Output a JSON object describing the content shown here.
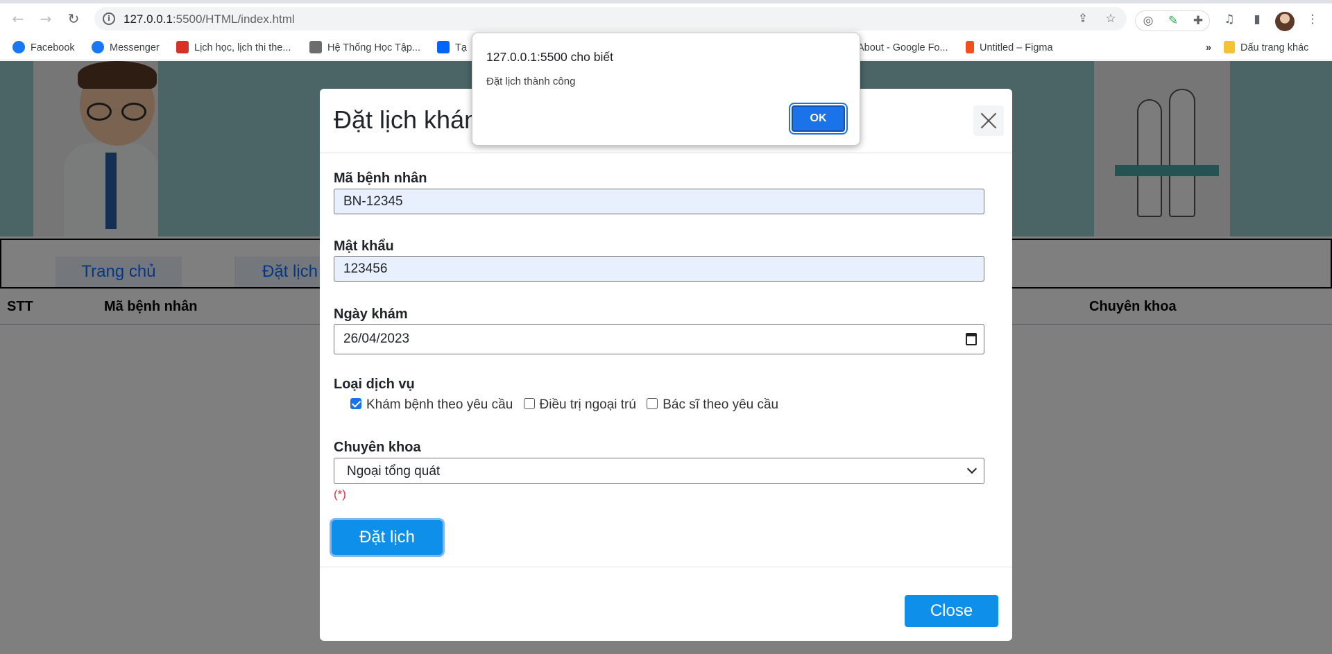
{
  "browser": {
    "url_host": "127.0.0.1",
    "url_rest": ":5500/HTML/index.html",
    "bookmarks": [
      {
        "label": "Facebook",
        "icon": "facebook-icon",
        "color": "#1877f2"
      },
      {
        "label": "Messenger",
        "icon": "facebook-icon",
        "color": "#1877f2"
      },
      {
        "label": "Lịch học, lịch thi the...",
        "icon": "site-icon",
        "color": "#d93025"
      },
      {
        "label": "Hệ Thống Học Tập...",
        "icon": "site-icon",
        "color": "#6d6d6d"
      },
      {
        "label": "Tạ",
        "icon": "trello-icon",
        "color": "#0065ff"
      },
      {
        "label": "About - Google Fo...",
        "icon": "google-icon",
        "color": ""
      },
      {
        "label": "Untitled – Figma",
        "icon": "figma-icon",
        "color": "#f24e1e"
      }
    ],
    "more_bookmarks": "»",
    "other_bookmarks": "Dấu trang khác"
  },
  "page": {
    "nav": [
      "Trang chủ",
      "Đặt lịch"
    ],
    "table_headers": {
      "stt": "STT",
      "patient_id": "Mã bệnh nhân",
      "specialty": "Chuyên khoa"
    }
  },
  "modal": {
    "title": "Đặt lịch khán",
    "fields": {
      "patient_id_label": "Mã bệnh nhân",
      "patient_id_value": "BN-12345",
      "password_label": "Mật khẩu",
      "password_value": "123456",
      "date_label": "Ngày khám",
      "date_value": "26/04/2023",
      "service_label": "Loại dịch vụ",
      "services": [
        {
          "label": "Khám bệnh theo yêu cầu",
          "checked": true
        },
        {
          "label": "Điều trị ngoại trú",
          "checked": false
        },
        {
          "label": "Bác sĩ theo yêu cầu",
          "checked": false
        }
      ],
      "specialty_label": "Chuyên khoa",
      "specialty_value": "Ngoại tổng quát",
      "required_note": "(*)"
    },
    "submit_label": "Đặt lịch",
    "close_label": "Close"
  },
  "alert": {
    "title": "127.0.0.1:5500 cho biết",
    "message": "Đặt lịch thành công",
    "ok_label": "OK"
  },
  "colors": {
    "primary": "#0d8fea",
    "alert_ok": "#1a73e8",
    "hero_bg": "#96c9cb",
    "required": "#dc3545"
  }
}
